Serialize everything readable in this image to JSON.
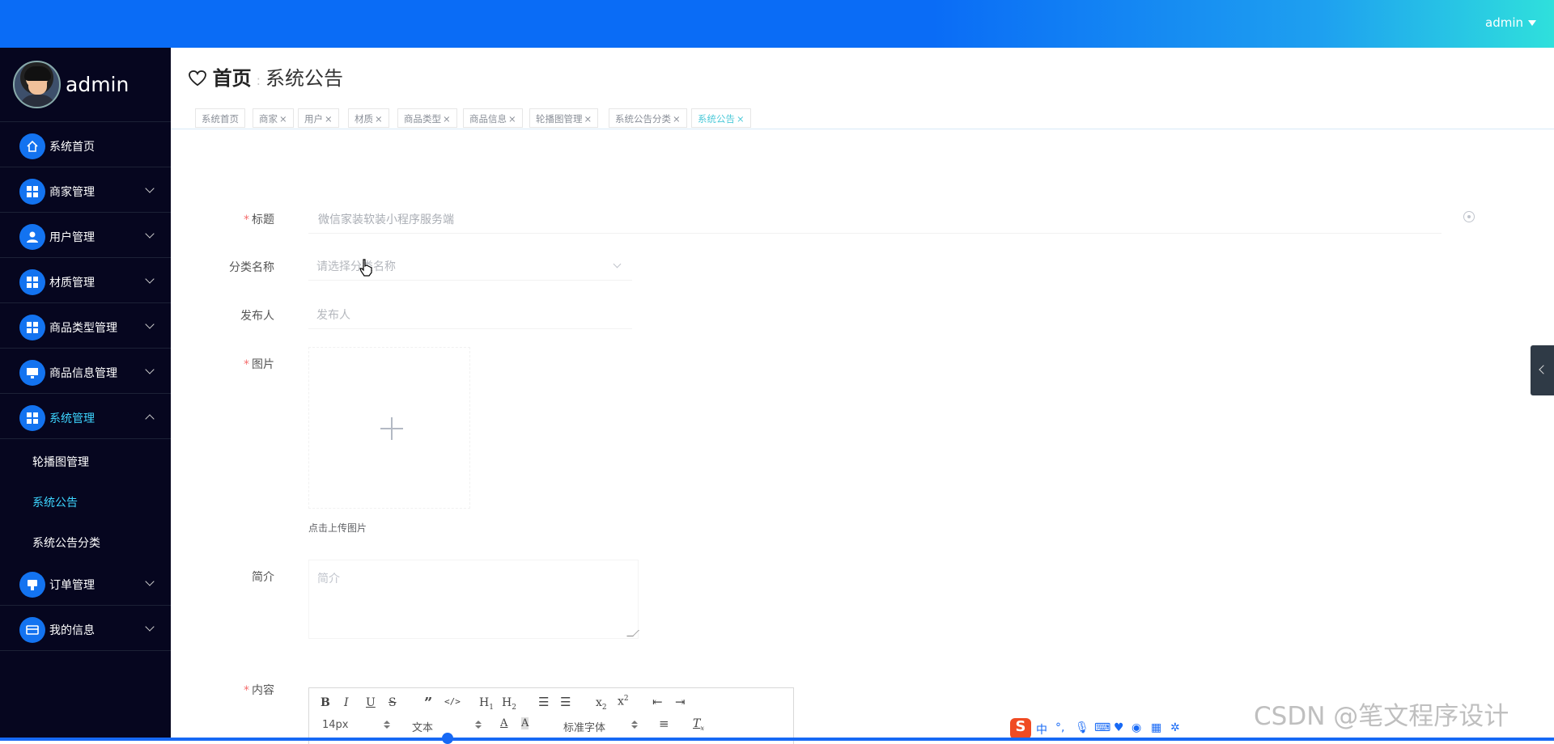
{
  "topbar": {
    "user_label": "admin"
  },
  "sidebar": {
    "username": "admin",
    "items": [
      {
        "label": "系统首页",
        "icon": "home-icon"
      },
      {
        "label": "商家管理",
        "icon": "grid-icon"
      },
      {
        "label": "用户管理",
        "icon": "user-icon"
      },
      {
        "label": "材质管理",
        "icon": "grid-icon"
      },
      {
        "label": "商品类型管理",
        "icon": "grid-icon"
      },
      {
        "label": "商品信息管理",
        "icon": "monitor-icon"
      },
      {
        "label": "系统管理",
        "icon": "grid-icon"
      },
      {
        "label": "订单管理",
        "icon": "cart-icon"
      },
      {
        "label": "我的信息",
        "icon": "card-icon"
      }
    ],
    "subitems": [
      "轮播图管理",
      "系统公告",
      "系统公告分类"
    ]
  },
  "breadcrumb": {
    "home": "首页",
    "current": "系统公告"
  },
  "tabs": [
    {
      "label": "系统首页",
      "closable": false
    },
    {
      "label": "商家",
      "closable": true
    },
    {
      "label": "用户",
      "closable": true
    },
    {
      "label": "材质",
      "closable": true
    },
    {
      "label": "商品类型",
      "closable": true
    },
    {
      "label": "商品信息",
      "closable": true
    },
    {
      "label": "轮播图管理",
      "closable": true
    },
    {
      "label": "系统公告分类",
      "closable": true
    },
    {
      "label": "系统公告",
      "closable": true
    }
  ],
  "form": {
    "title_label": "标题",
    "title_value": "微信家装软装小程序服务端",
    "category_label": "分类名称",
    "category_placeholder": "请选择分类名称",
    "publisher_label": "发布人",
    "publisher_placeholder": "发布人",
    "image_label": "图片",
    "upload_hint": "点击上传图片",
    "intro_label": "简介",
    "intro_placeholder": "简介",
    "content_label": "内容"
  },
  "editor": {
    "font_size": "14px",
    "paragraph": "文本",
    "font_family": "标准字体"
  },
  "watermark": "CSDN @笔文程序设计",
  "colors": {
    "accent": "#1373f0",
    "active_menu": "#3dd5ff",
    "sidebar_bg": "#06061f",
    "required": "#f56c6c"
  }
}
